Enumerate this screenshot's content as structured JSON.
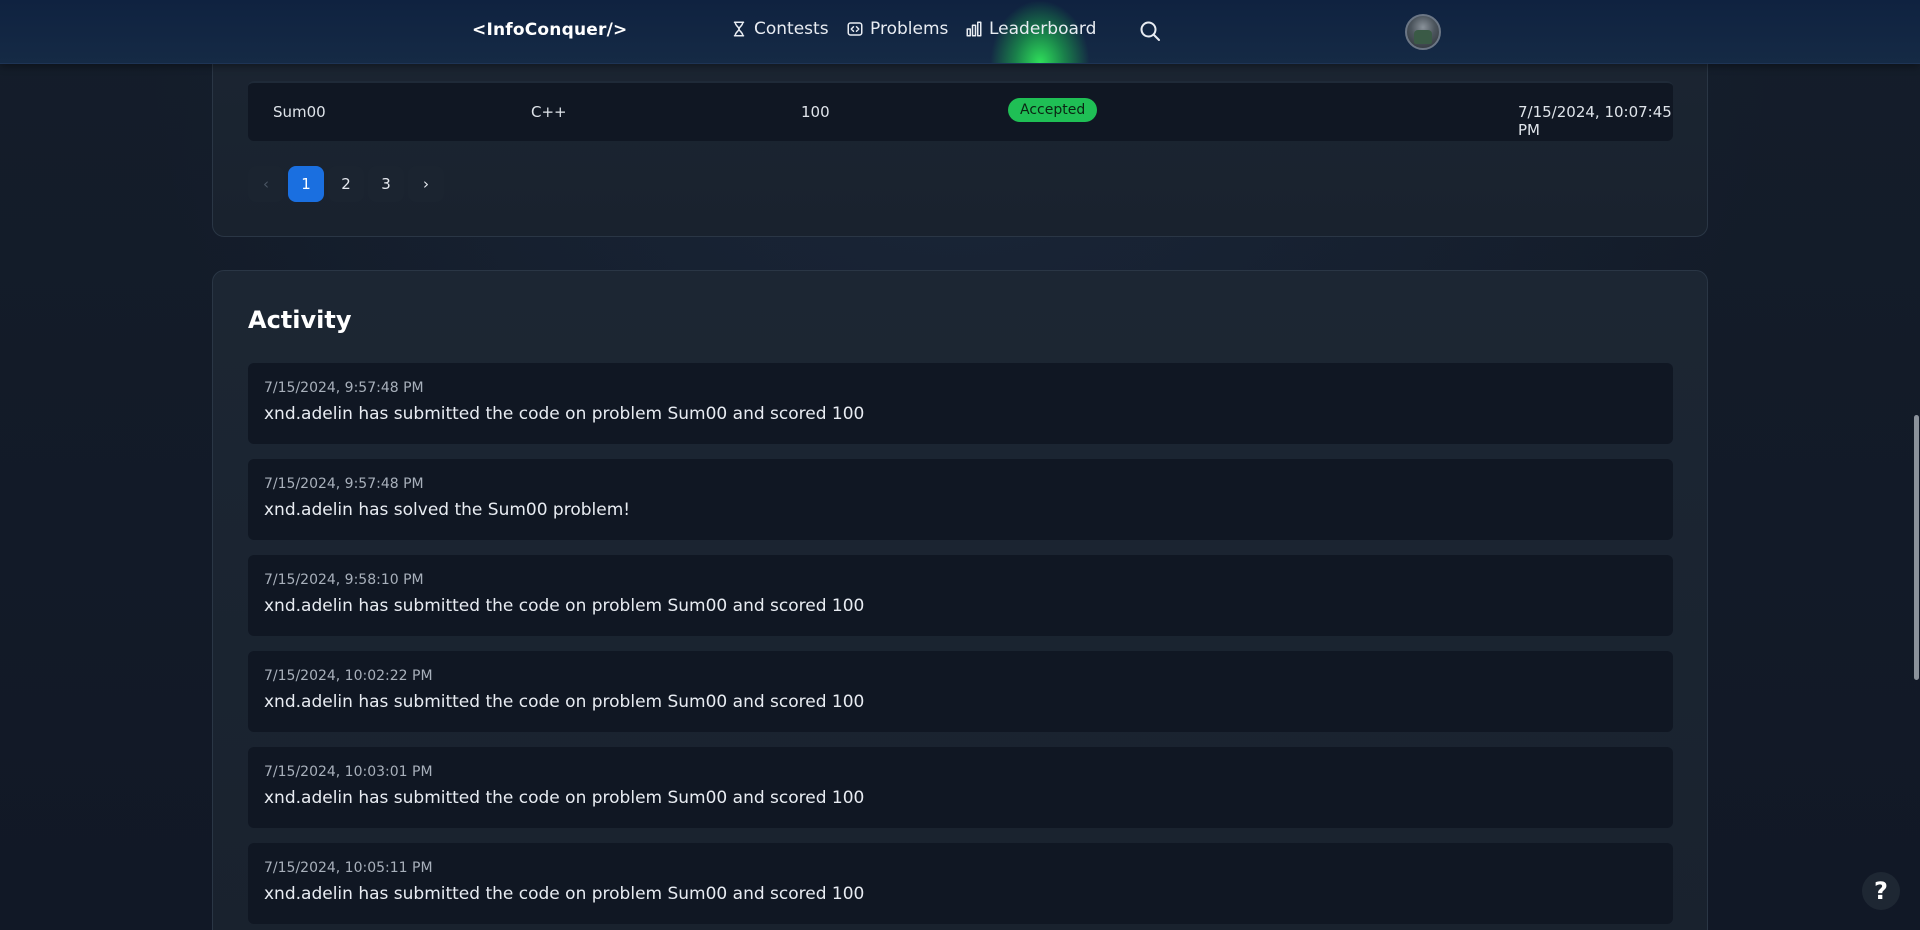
{
  "header": {
    "brand": "<InfoConquer/>",
    "nav": [
      {
        "label": "Contests",
        "icon": "hourglass-icon"
      },
      {
        "label": "Problems",
        "icon": "code-icon"
      },
      {
        "label": "Leaderboard",
        "icon": "bar-chart-icon"
      }
    ]
  },
  "submissions": {
    "row": {
      "problem": "Sum00",
      "language": "C++",
      "score": "100",
      "status": "Accepted",
      "date": "7/15/2024, 10:07:45 PM"
    },
    "pagination": {
      "prev": "‹",
      "pages": [
        "1",
        "2",
        "3"
      ],
      "next": "›",
      "active_page": "1"
    }
  },
  "activity": {
    "title": "Activity",
    "items": [
      {
        "time": "7/15/2024, 9:57:48 PM",
        "text": "xnd.adelin has submitted the code on problem Sum00 and scored 100"
      },
      {
        "time": "7/15/2024, 9:57:48 PM",
        "text": "xnd.adelin has solved the Sum00 problem!"
      },
      {
        "time": "7/15/2024, 9:58:10 PM",
        "text": "xnd.adelin has submitted the code on problem Sum00 and scored 100"
      },
      {
        "time": "7/15/2024, 10:02:22 PM",
        "text": "xnd.adelin has submitted the code on problem Sum00 and scored 100"
      },
      {
        "time": "7/15/2024, 10:03:01 PM",
        "text": "xnd.adelin has submitted the code on problem Sum00 and scored 100"
      },
      {
        "time": "7/15/2024, 10:05:11 PM",
        "text": "xnd.adelin has submitted the code on problem Sum00 and scored 100"
      }
    ]
  },
  "help": {
    "label": "?"
  },
  "colors": {
    "accent": "#1a6fe0",
    "accepted": "#1fbf55",
    "glow": "#2fe05a"
  }
}
